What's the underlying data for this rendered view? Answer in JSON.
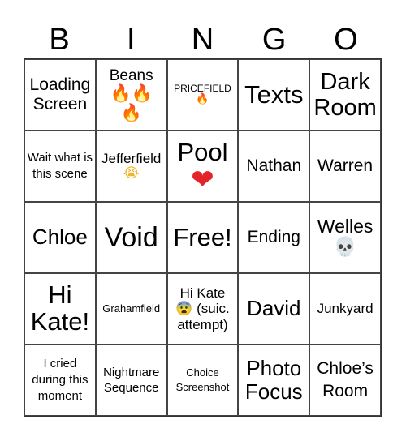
{
  "header": {
    "letters": [
      "B",
      "I",
      "N",
      "G",
      "O"
    ]
  },
  "cells": [
    {
      "text": "Loading Screen",
      "emoji": ""
    },
    {
      "text": "Beans",
      "emoji": "🔥🔥🔥",
      "emoji_name": "fire-icon"
    },
    {
      "text": "PRICEFIELD",
      "emoji": "🔥",
      "emoji_name": "fire-icon"
    },
    {
      "text": "Texts",
      "emoji": ""
    },
    {
      "text": "Dark Room",
      "emoji": ""
    },
    {
      "text": "Wait what is this scene",
      "emoji": ""
    },
    {
      "text": "Jefferfield",
      "emoji": "😭",
      "emoji_name": "crying-face-icon"
    },
    {
      "text": "Pool",
      "emoji": "❤️",
      "emoji_name": "heart-icon"
    },
    {
      "text": "Nathan",
      "emoji": ""
    },
    {
      "text": "Warren",
      "emoji": ""
    },
    {
      "text": "Chloe",
      "emoji": ""
    },
    {
      "text": "Void",
      "emoji": ""
    },
    {
      "text": "Free!",
      "emoji": ""
    },
    {
      "text": "Ending",
      "emoji": ""
    },
    {
      "text": "Welles",
      "emoji": "💀",
      "emoji_name": "skull-icon"
    },
    {
      "text": "Hi Kate!",
      "emoji": ""
    },
    {
      "text": "Grahamfield",
      "emoji": ""
    },
    {
      "text_before": "Hi Kate",
      "emoji": "😨",
      "text_after": "(suic. attempt)",
      "emoji_name": "fearful-face-icon"
    },
    {
      "text": "David",
      "emoji": ""
    },
    {
      "text": "Junkyard",
      "emoji": ""
    },
    {
      "text": "I cried during this moment",
      "emoji": ""
    },
    {
      "text": "Nightmare Sequence",
      "emoji": ""
    },
    {
      "text": "Choice Screenshot",
      "emoji": ""
    },
    {
      "text": "Photo Focus",
      "emoji": ""
    },
    {
      "text": "Chloe’s Room",
      "emoji": ""
    }
  ]
}
